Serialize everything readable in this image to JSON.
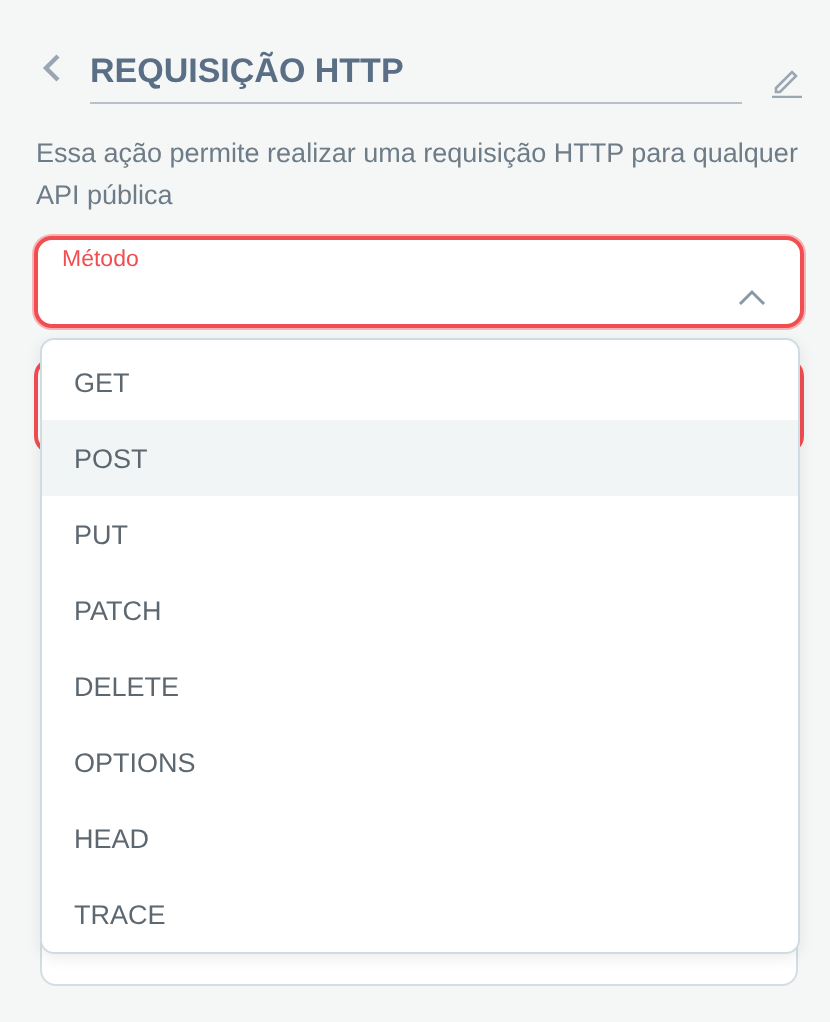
{
  "header": {
    "title": "REQUISIÇÃO HTTP"
  },
  "description": "Essa ação permite realizar uma requisição HTTP para qualquer API pública",
  "method_field": {
    "label": "Método",
    "expanded": true,
    "error": true
  },
  "menu": [
    {
      "label": "GET",
      "hovered": false
    },
    {
      "label": "POST",
      "hovered": true
    },
    {
      "label": "PUT",
      "hovered": false
    },
    {
      "label": "PATCH",
      "hovered": false
    },
    {
      "label": "DELETE",
      "hovered": false
    },
    {
      "label": "OPTIONS",
      "hovered": false
    },
    {
      "label": "HEAD",
      "hovered": false
    },
    {
      "label": "TRACE",
      "hovered": false
    }
  ]
}
